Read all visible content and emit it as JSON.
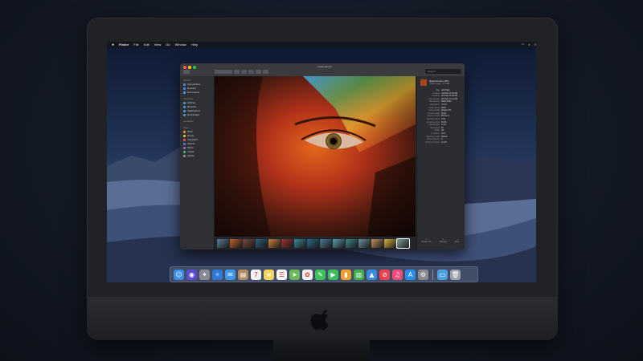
{
  "menubar": {
    "app_name": "Finder",
    "items": [
      "File",
      "Edit",
      "View",
      "Go",
      "Window",
      "Help"
    ]
  },
  "window": {
    "title": "Lorem Ipsum",
    "search_placeholder": "Search"
  },
  "sidebar": {
    "sections": [
      {
        "header": "iCloud",
        "items": [
          "iCloud Drive",
          "Desktop",
          "Documents"
        ]
      },
      {
        "header": "Favorites",
        "items": [
          "AirDrop",
          "Recents",
          "Applications",
          "Downloads"
        ]
      },
      {
        "header": "Locations",
        "items": []
      },
      {
        "header": "Tags",
        "items": [
          {
            "label": "Work",
            "color": "#ff9a1f"
          },
          {
            "label": "Home",
            "color": "#f5d23a"
          },
          {
            "label": "Important",
            "color": "#ff4f4f"
          },
          {
            "label": "School",
            "color": "#4a8fe8"
          },
          {
            "label": "Music",
            "color": "#b05fe0"
          },
          {
            "label": "Travel",
            "color": "#38c46a"
          },
          {
            "label": "Family",
            "color": "#9a9a9a"
          }
        ]
      }
    ]
  },
  "inspector": {
    "file_name": "Rainbow Eye.JPG",
    "file_kind": "JPEG image - 2.1 MB",
    "rows": [
      {
        "k": "Tags",
        "v": "Add Tags"
      },
      {
        "k": "Created",
        "v": "2/15/18, 11:04 AM"
      },
      {
        "k": "Modified",
        "v": "2/15/18, 11:04 AM"
      },
      {
        "k": "Last opened",
        "v": "2/15/18, 11:04 AM"
      },
      {
        "k": "Dimensions",
        "v": "3024×4032"
      },
      {
        "k": "Resolution",
        "v": "72×72"
      },
      {
        "k": "Color space",
        "v": "RGB"
      },
      {
        "k": "Color profile",
        "v": "Display P3"
      },
      {
        "k": "Device make",
        "v": "Apple"
      },
      {
        "k": "Device model",
        "v": "iPhone X"
      },
      {
        "k": "Aperture value",
        "v": "1.69"
      },
      {
        "k": "Exposure time",
        "v": "1/120"
      },
      {
        "k": "Focal length",
        "v": "4 mm"
      },
      {
        "k": "ISO speed",
        "v": "40"
      },
      {
        "k": "Flash",
        "v": "No"
      },
      {
        "k": "F number",
        "v": "f/1.8"
      },
      {
        "k": "Metering mode",
        "v": "Pattern"
      },
      {
        "k": "White balance",
        "v": "0"
      },
      {
        "k": "Content Creator",
        "v": "11.2.5"
      }
    ],
    "actions": [
      "Rotate Left",
      "Markup",
      "More..."
    ]
  },
  "filmstrip_colors": [
    "#5a7a9a",
    "#c0602a",
    "#7a4a3a",
    "#2f5f7f",
    "#d08040",
    "#a03030",
    "#3a8a9a",
    "#2a6a8a",
    "#4a7a9a",
    "#5aa0b0",
    "#3a8a8a",
    "#6a90a0",
    "#c09060",
    "#e0b040",
    "#80a0a0",
    "#a0b0c0",
    "#507080"
  ],
  "dock": {
    "apps": [
      {
        "name": "finder-icon",
        "glyph": "☺",
        "bg": "#3a8ee8"
      },
      {
        "name": "siri-icon",
        "glyph": "◉",
        "bg": "#5a4ad0"
      },
      {
        "name": "launchpad-icon",
        "glyph": "✦",
        "bg": "#8a8a95"
      },
      {
        "name": "safari-icon",
        "glyph": "✧",
        "bg": "#2f7ad8"
      },
      {
        "name": "mail-icon",
        "glyph": "✉",
        "bg": "#3e98f0"
      },
      {
        "name": "contacts-icon",
        "glyph": "▤",
        "bg": "#b08a60"
      },
      {
        "name": "calendar-icon",
        "glyph": "7",
        "bg": "#f4f4f4"
      },
      {
        "name": "notes-icon",
        "glyph": "≡",
        "bg": "#f2d45a"
      },
      {
        "name": "reminders-icon",
        "glyph": "☰",
        "bg": "#f7f7f7"
      },
      {
        "name": "maps-icon",
        "glyph": "➤",
        "bg": "#6ab85a"
      },
      {
        "name": "photos-icon",
        "glyph": "✿",
        "bg": "#f0f0f0"
      },
      {
        "name": "messages-icon",
        "glyph": "✎",
        "bg": "#3ec35a"
      },
      {
        "name": "facetime-icon",
        "glyph": "▶",
        "bg": "#3dbf5e"
      },
      {
        "name": "pages-icon",
        "glyph": "▮",
        "bg": "#f0a030"
      },
      {
        "name": "numbers-icon",
        "glyph": "▥",
        "bg": "#40b050"
      },
      {
        "name": "keynote-icon",
        "glyph": "▲",
        "bg": "#3a8ae0"
      },
      {
        "name": "news-icon",
        "glyph": "⊘",
        "bg": "#f04050"
      },
      {
        "name": "music-icon",
        "glyph": "♫",
        "bg": "#f04a7a"
      },
      {
        "name": "appstore-icon",
        "glyph": "A",
        "bg": "#2a8ef0"
      },
      {
        "name": "system-preferences-icon",
        "glyph": "⚙",
        "bg": "#8a8a90"
      }
    ],
    "trailing": [
      {
        "name": "folder-icon",
        "glyph": "▭",
        "bg": "#4aa0e0"
      },
      {
        "name": "trash-icon",
        "glyph": "🗑",
        "bg": "#9aa0aa"
      }
    ]
  }
}
